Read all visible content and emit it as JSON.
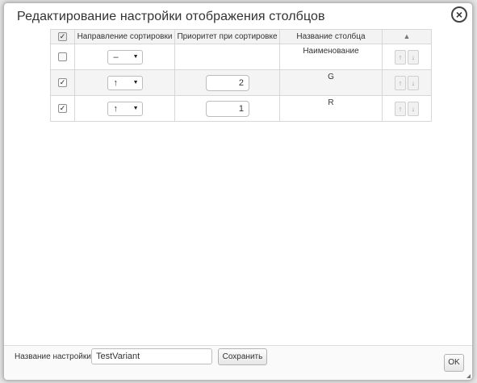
{
  "dialog": {
    "title": "Редактирование настройки отображения столбцов",
    "close_icon": "close-circle-icon"
  },
  "table": {
    "headers": {
      "check_all": "checkbox-checked-icon",
      "sort_direction": "Направление сортировки",
      "sort_priority": "Приоритет при сортировке",
      "column_name": "Название столбца",
      "move": "sort-updown-icon"
    },
    "rows": [
      {
        "checked": false,
        "direction": "–",
        "priority": "",
        "name": "Наименование"
      },
      {
        "checked": true,
        "direction": "↑",
        "priority": "2",
        "name": "G"
      },
      {
        "checked": true,
        "direction": "↑",
        "priority": "1",
        "name": "R"
      }
    ],
    "move_up_label": "↑",
    "move_down_label": "↓",
    "select_caret": "▼",
    "check_mark": "✓"
  },
  "footer": {
    "setting_name_label": "Название настройки",
    "setting_name_value": "TestVariant",
    "save_label": "Сохранить",
    "ok_label": "OK"
  }
}
